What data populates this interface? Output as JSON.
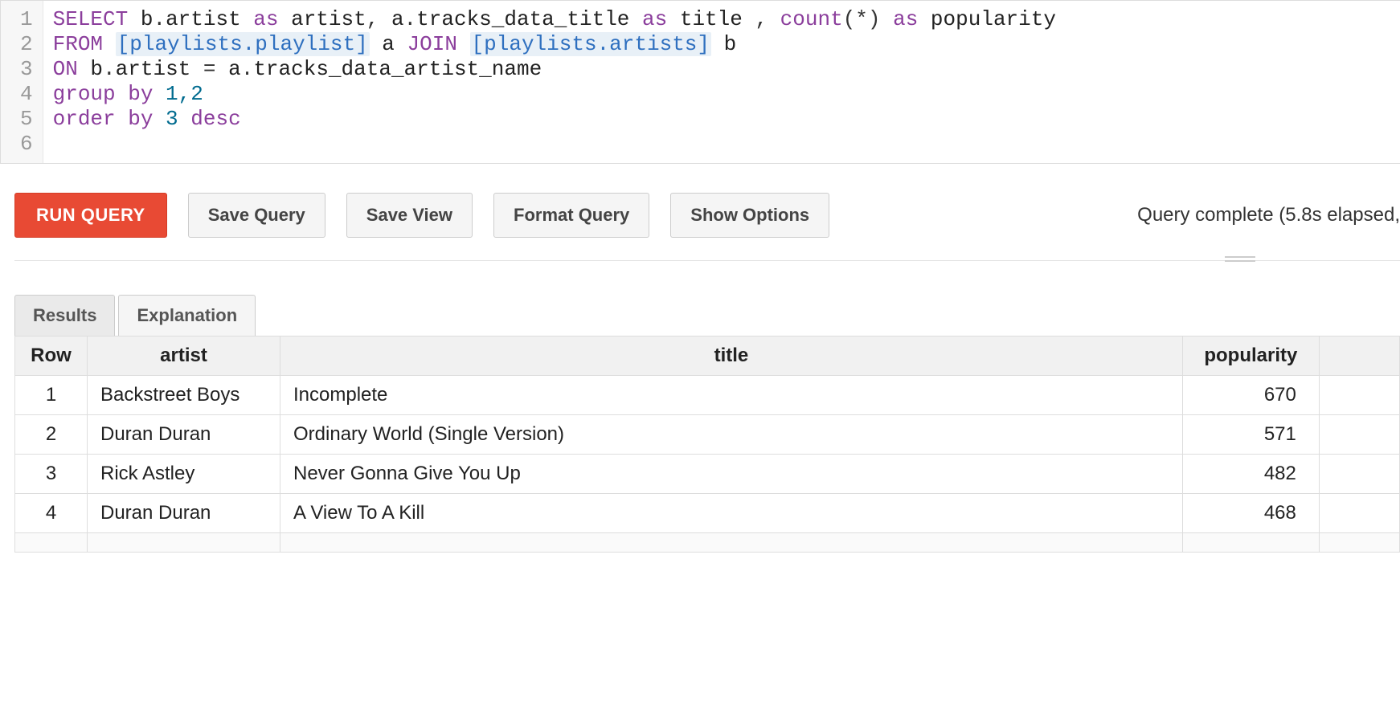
{
  "editor": {
    "lines": [
      {
        "num": "1"
      },
      {
        "num": "2"
      },
      {
        "num": "3"
      },
      {
        "num": "4"
      },
      {
        "num": "5"
      },
      {
        "num": "6"
      }
    ],
    "sql": {
      "l1_select": "SELECT",
      "l1_b": " b",
      "l1_dot1": ".",
      "l1_artist1": "artist ",
      "l1_as1": "as",
      "l1_artist2": " artist",
      "l1_comma1": ", ",
      "l1_a": "a",
      "l1_dot2": ".",
      "l1_tdt": "tracks_data_title ",
      "l1_as2": "as",
      "l1_title": " title ",
      "l1_comma2": ", ",
      "l1_count": "count",
      "l1_paren": "(*) ",
      "l1_as3": "as",
      "l1_pop": " popularity",
      "l2_from": "FROM",
      "l2_sp1": " ",
      "l2_t1": "[playlists.playlist]",
      "l2_a": " a ",
      "l2_join": "JOIN",
      "l2_sp2": " ",
      "l2_t2": "[playlists.artists]",
      "l2_b": " b",
      "l3_on": "ON",
      "l3_b": " b",
      "l3_dot1": ".",
      "l3_artist": "artist ",
      "l3_eq": "= ",
      "l3_a": "a",
      "l3_dot2": ".",
      "l3_tdan": "tracks_data_artist_name",
      "l4_group": "group",
      "l4_sp": " ",
      "l4_by": "by",
      "l4_nums": " 1,2",
      "l5_order": "order",
      "l5_sp": " ",
      "l5_by": "by",
      "l5_num": " 3 ",
      "l5_desc": "desc"
    }
  },
  "toolbar": {
    "run": "RUN QUERY",
    "save_query": "Save Query",
    "save_view": "Save View",
    "format_query": "Format Query",
    "show_options": "Show Options",
    "status": "Query complete (5.8s elapsed, "
  },
  "tabs": {
    "results": "Results",
    "explanation": "Explanation"
  },
  "results": {
    "headers": {
      "row": "Row",
      "artist": "artist",
      "title": "title",
      "popularity": "popularity"
    },
    "rows": [
      {
        "n": "1",
        "artist": "Backstreet Boys",
        "title": "Incomplete",
        "popularity": "670"
      },
      {
        "n": "2",
        "artist": "Duran Duran",
        "title": "Ordinary World (Single Version)",
        "popularity": "571"
      },
      {
        "n": "3",
        "artist": "Rick Astley",
        "title": "Never Gonna Give You Up",
        "popularity": "482"
      },
      {
        "n": "4",
        "artist": "Duran Duran",
        "title": "A View To A Kill",
        "popularity": "468"
      }
    ]
  }
}
